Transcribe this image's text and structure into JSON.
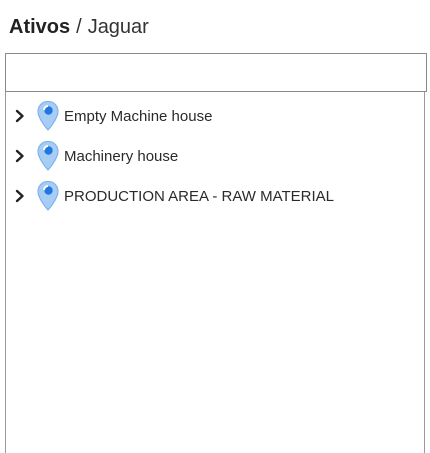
{
  "breadcrumb": {
    "root": "Ativos",
    "separator": "/",
    "current": "Jaguar"
  },
  "search": {
    "value": "",
    "placeholder": ""
  },
  "tree": {
    "items": [
      {
        "label": "Empty Machine house",
        "icon": "location-pin-icon",
        "expand_icon": "chevron-right-icon"
      },
      {
        "label": "Machinery house",
        "icon": "location-pin-icon",
        "expand_icon": "chevron-right-icon"
      },
      {
        "label": "PRODUCTION AREA - RAW MATERIAL",
        "icon": "location-pin-icon",
        "expand_icon": "chevron-right-icon"
      }
    ]
  },
  "colors": {
    "pin_fill": "#a8cdf5",
    "pin_stroke": "#5a9de6",
    "pin_dot": "#1e78e0",
    "text": "#222222",
    "border": "#8a8a8a"
  }
}
